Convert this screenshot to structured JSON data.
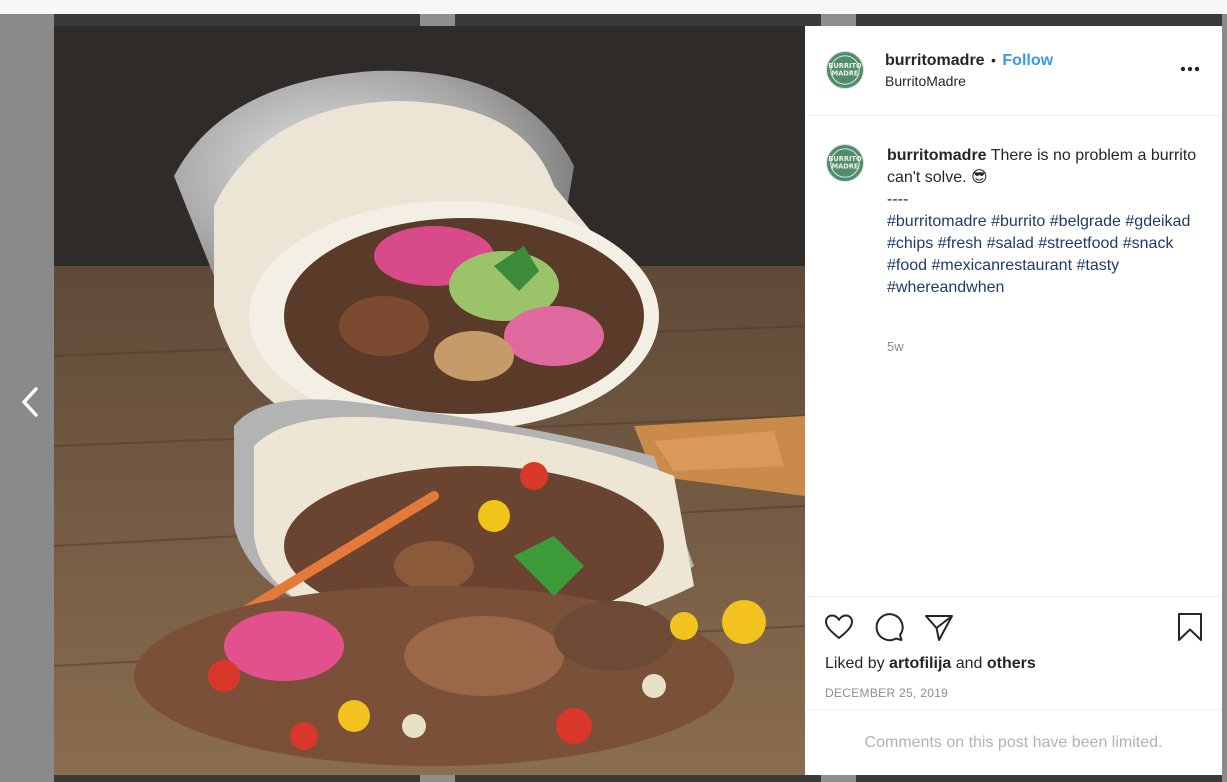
{
  "post": {
    "username": "burritomadre",
    "separator": "•",
    "follow_label": "Follow",
    "subtitle": "BurritoMadre",
    "avatar_text": "BURRITO MADRE",
    "more_icon": "more-options-icon"
  },
  "caption": {
    "username": "burritomadre",
    "text": "There is no problem a burrito can't solve.",
    "emoji": "😎",
    "divider": "----",
    "hashtags": [
      "#burritomadre",
      "#burrito",
      "#belgrade",
      "#gdeikad",
      "#chips",
      "#fresh",
      "#salad",
      "#streetfood",
      "#snack",
      "#food",
      "#mexicanrestaurant",
      "#tasty",
      "#whereandwhen"
    ],
    "time": "5w"
  },
  "actions": {
    "like_icon": "heart-icon",
    "comment_icon": "comment-icon",
    "share_icon": "share-icon",
    "save_icon": "bookmark-icon",
    "liked_prefix": "Liked by",
    "liked_user": "artofilija",
    "liked_and": "and",
    "liked_others": "others",
    "date": "DECEMBER 25, 2019",
    "comments_limited": "Comments on this post have been limited."
  },
  "nav": {
    "prev_icon": "chevron-left-icon"
  },
  "colors": {
    "link_blue": "#3897f0",
    "hashtag": "#1f3b6b",
    "avatar_green": "#4f8d6e"
  }
}
